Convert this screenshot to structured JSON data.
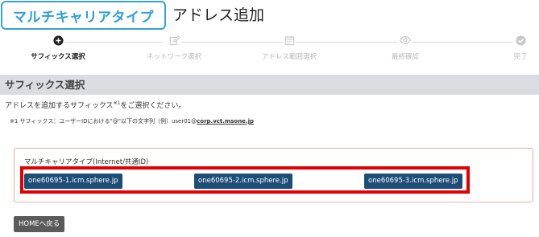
{
  "header": {
    "brand": "マルチキャリアタイプ",
    "title": "アドレス追加"
  },
  "stepper": {
    "steps": [
      {
        "label": "サフィックス選択",
        "icon": "plus-circle-icon",
        "active": true
      },
      {
        "label": "ネットワーク選択",
        "icon": "edit-icon",
        "active": false
      },
      {
        "label": "アドレス範囲選択",
        "icon": "calendar-icon",
        "active": false
      },
      {
        "label": "最終確認",
        "icon": "eye-icon",
        "active": false
      },
      {
        "label": "完了",
        "icon": "check-circle-icon",
        "active": false
      }
    ]
  },
  "section": {
    "title": "サフィックス選択",
    "instruction_pre": "アドレスを追加するサフィックス",
    "instruction_sup": "※1",
    "instruction_post": "をご選択ください。",
    "footnote_pre": "※1  サフィックス：ユーザーIDにおける\"@\"以下の文字列（例）user01@",
    "footnote_bold": "corp.vct.msone.jp"
  },
  "panel": {
    "title": "マルチキャリアタイプ(Internet/共通ID)",
    "suffixes": [
      "one60695-1.icm.sphere.jp",
      "one60695-2.icm.sphere.jp",
      "one60695-3.icm.sphere.jp"
    ]
  },
  "footer": {
    "home_label": "HOMEへ戻る"
  },
  "colors": {
    "brand": "#2e9fd9",
    "suffix_button": "#1d4e77",
    "highlight": "#e00000",
    "section_bar": "#d9dde1",
    "home_button": "#5b5b5b"
  }
}
